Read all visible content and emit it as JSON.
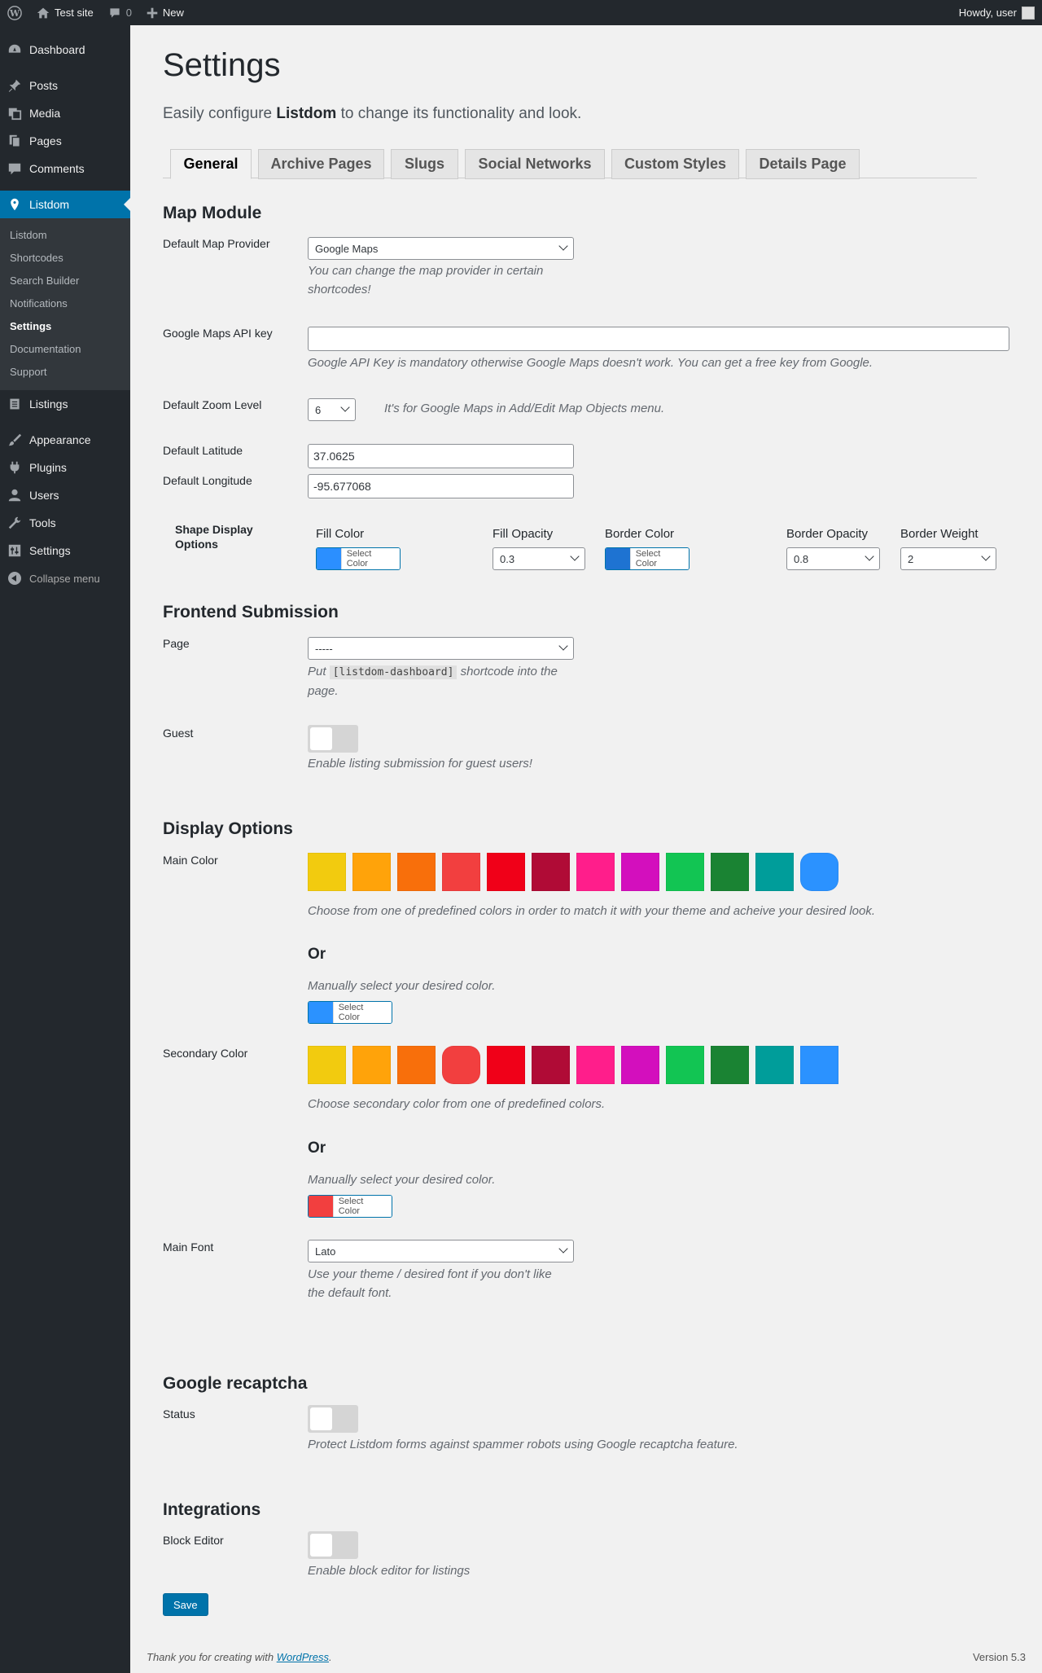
{
  "adminbar": {
    "site_name": "Test site",
    "comments_count": "0",
    "new_label": "New",
    "howdy": "Howdy, user"
  },
  "sidebar": {
    "items_top": [
      {
        "label": "Dashboard",
        "icon": "dashboard-icon"
      },
      {
        "label": "Posts",
        "icon": "pin-icon"
      },
      {
        "label": "Media",
        "icon": "media-icon"
      },
      {
        "label": "Pages",
        "icon": "pages-icon"
      },
      {
        "label": "Comments",
        "icon": "comment-icon"
      }
    ],
    "current": {
      "label": "Listdom",
      "icon": "location-pin-icon"
    },
    "submenu": [
      "Listdom",
      "Shortcodes",
      "Search Builder",
      "Notifications",
      "Settings",
      "Documentation",
      "Support"
    ],
    "submenu_active": "Settings",
    "listings": "Listings",
    "items_bottom": [
      {
        "label": "Appearance",
        "icon": "brush-icon"
      },
      {
        "label": "Plugins",
        "icon": "plug-icon"
      },
      {
        "label": "Users",
        "icon": "user-icon"
      },
      {
        "label": "Tools",
        "icon": "wrench-icon"
      },
      {
        "label": "Settings",
        "icon": "sliders-icon"
      }
    ],
    "collapse": "Collapse menu"
  },
  "page": {
    "title": "Settings",
    "intro_pre": "Easily configure ",
    "intro_bold": "Listdom",
    "intro_post": " to change its functionality and look."
  },
  "tabs": [
    "General",
    "Archive Pages",
    "Slugs",
    "Social Networks",
    "Custom Styles",
    "Details Page"
  ],
  "map": {
    "heading": "Map Module",
    "provider_label": "Default Map Provider",
    "provider_value": "Google Maps",
    "provider_desc_1": "You can change the map provider in certain",
    "provider_desc_2": "shortcodes!",
    "api_label": "Google Maps API key",
    "api_value": "",
    "api_desc": "Google API Key is mandatory otherwise Google Maps doesn't work. You can get a free key from Google.",
    "zoom_label": "Default Zoom Level",
    "zoom_value": "6",
    "zoom_desc": "It's for Google Maps in Add/Edit Map Objects menu.",
    "lat_label": "Default Latitude",
    "lat_value": "37.0625",
    "lng_label": "Default Longitude",
    "lng_value": "-95.677068",
    "shape_title_1": "Shape Display",
    "shape_title_2": "Options",
    "fill_color_label": "Fill Color",
    "fill_color": "#2b8fff",
    "fill_opacity_label": "Fill Opacity",
    "fill_opacity": "0.3",
    "border_color_label": "Border Color",
    "border_color": "#1e73d2",
    "border_opacity_label": "Border Opacity",
    "border_opacity": "0.8",
    "border_weight_label": "Border Weight",
    "border_weight": "2",
    "select_color": "Select Color"
  },
  "frontend": {
    "heading": "Frontend Submission",
    "page_label": "Page",
    "page_value": "-----",
    "page_desc_1": "Put ",
    "page_code": "[listdom-dashboard]",
    "page_desc_2": " shortcode into the",
    "page_desc_3": "page.",
    "guest_label": "Guest",
    "guest_desc": "Enable listing submission for guest users!"
  },
  "display": {
    "heading": "Display Options",
    "main_color_label": "Main Color",
    "palette": [
      "#f2cb0f",
      "#ffa30a",
      "#f86f0b",
      "#f23f3f",
      "#f00018",
      "#b00b36",
      "#ff1e8b",
      "#d30fbd",
      "#12c553",
      "#1a8333",
      "#009d9a",
      "#2b92ff"
    ],
    "main_selected_index": 11,
    "main_desc": "Choose from one of predefined colors in order to match it with your theme and acheive your desired look.",
    "or": "Or",
    "manual_desc": "Manually select your desired color.",
    "main_manual_color": "#2b92ff",
    "secondary_label": "Secondary Color",
    "secondary_selected_index": 3,
    "secondary_desc": "Choose secondary color from one of predefined colors.",
    "secondary_manual_color": "#f23f3f",
    "font_label": "Main Font",
    "font_value": "Lato",
    "font_desc_1": "Use your theme / desired font if you don't like",
    "font_desc_2": "the default font.",
    "select_color": "Select Color"
  },
  "recaptcha": {
    "heading": "Google recaptcha",
    "status_label": "Status",
    "status_desc": "Protect Listdom forms against spammer robots using Google recaptcha feature."
  },
  "integrations": {
    "heading": "Integrations",
    "block_label": "Block Editor",
    "block_desc": "Enable block editor for listings"
  },
  "save_label": "Save",
  "footer": {
    "thanks_pre": "Thank you for creating with ",
    "thanks_link": "WordPress",
    "thanks_post": ".",
    "version": "Version 5.3"
  }
}
